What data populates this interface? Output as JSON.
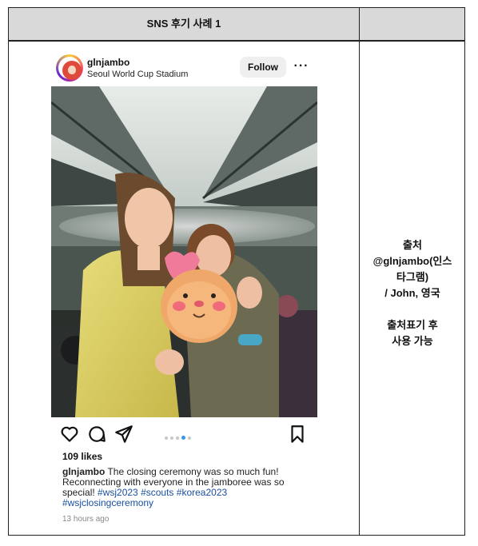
{
  "table": {
    "header": "SNS 후기 사례 1",
    "source_lines": [
      "출처",
      "@glnjambo(인스",
      "타그램)",
      "/ John, 영국"
    ],
    "usage_lines": [
      "출처표기 후",
      "사용 가능"
    ]
  },
  "post": {
    "username": "glnjambo",
    "location": "Seoul World Cup Stadium",
    "follow_label": "Follow",
    "more_label": "···",
    "likes": "109 likes",
    "caption_user": "glnjambo",
    "caption_text": " The closing ceremony was so much fun! Reconnecting with everyone in the jamboree was so special! ",
    "hashtags": [
      "#wsj2023",
      "#scouts",
      "#korea2023",
      "#wsjclosingceremony"
    ],
    "time": "13 hours ago",
    "carousel": {
      "count": 5,
      "active_index": 3
    }
  },
  "colors": {
    "header_bg": "#d9d9d9",
    "follow_bg": "#efefef",
    "hashtag": "#1a4fa0",
    "carousel_active": "#3897f0"
  },
  "icons": [
    "heart-icon",
    "comment-icon",
    "share-icon",
    "bookmark-icon",
    "more-icon"
  ]
}
